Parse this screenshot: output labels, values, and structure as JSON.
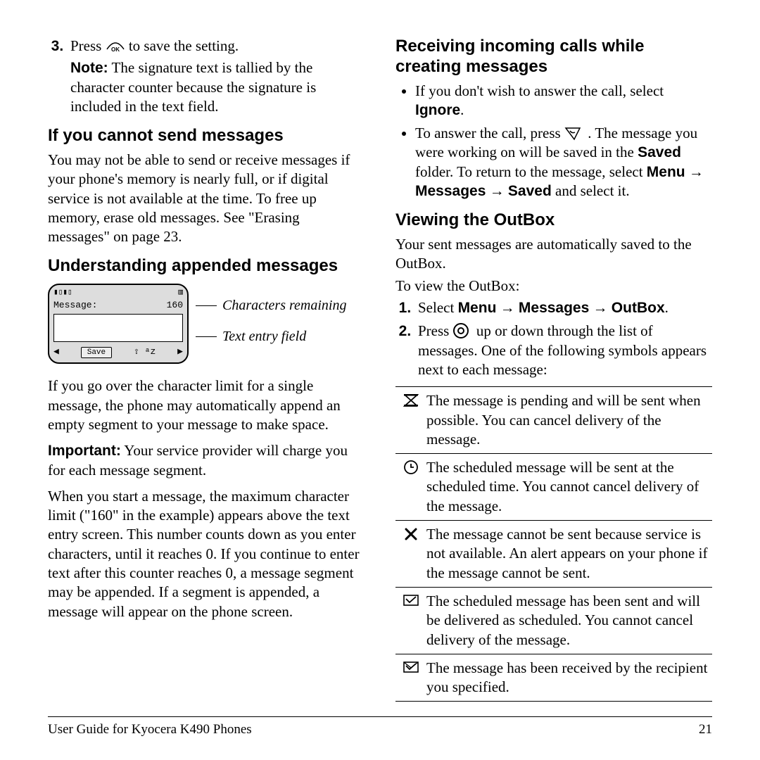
{
  "left": {
    "step3_a": "Press ",
    "step3_b": " to save the setting.",
    "note_label": "Note:",
    "note_text": "  The signature text is tallied by the character counter because the signature is included in the text field.",
    "h_cannot": "If you cannot send messages",
    "p_cannot": "You may not be able to send or receive messages if your phone's memory is nearly full, or if digital service is not available at the time. To free up memory, erase old messages. See \"Erasing messages\" on page 23.",
    "h_under": "Understanding appended messages",
    "phone_msg": "Message:",
    "phone_count": "160",
    "phone_save": "Save",
    "annot_chars": "Characters remaining",
    "annot_field": "Text entry field",
    "p_over": "If you go over the character limit for a single message, the phone may automatically append an empty segment to your message to make space.",
    "imp_label": "Important:",
    "p_imp": "  Your service provider will charge you for each message segment.",
    "p_start": "When you start a message, the maximum character limit (\"160\" in the example) appears above the text entry screen. This number counts down as you enter characters, until it reaches 0. If you continue to enter text after this counter reaches 0, a message segment may be appended. If a segment is appended, a message will appear on the phone screen."
  },
  "right": {
    "h_recv": "Receiving incoming calls while creating messages",
    "b1_a": "If you don't wish to answer the call, select ",
    "b1_b": "Ignore",
    "b1_c": ".",
    "b2_a": "To answer the call, press ",
    "b2_b": ". The message you were working on will be saved in the ",
    "b2_c": "Saved",
    "b2_d": " folder. To return to the message, select ",
    "b2_menu": "Menu",
    "b2_msgs": "Messages",
    "b2_saved": "Saved",
    "b2_end": " and select it.",
    "h_outbox": "Viewing the OutBox",
    "p_outbox1": "Your sent messages are automatically saved to the OutBox.",
    "p_outbox2": "To view the OutBox:",
    "o1_a": "Select ",
    "o1_menu": "Menu",
    "o1_msgs": "Messages",
    "o1_outbox": "OutBox",
    "o1_end": ".",
    "o2_a": "Press ",
    "o2_b": "  up or down through the list of messages. One of the following symbols appears next to each message:",
    "tbl": {
      "r1": "The message is pending and will be sent when possible. You can cancel delivery of the message.",
      "r2": "The scheduled message will be sent at the scheduled time. You cannot cancel delivery of the message.",
      "r3": "The message cannot be sent because service is not available. An alert appears on your phone if the message cannot be sent.",
      "r4": "The scheduled message has been sent and will be delivered as scheduled. You cannot cancel delivery of the message.",
      "r5": "The message has been received by the recipient you specified."
    }
  },
  "footer": {
    "left": "User Guide for Kyocera K490 Phones",
    "right": "21"
  }
}
